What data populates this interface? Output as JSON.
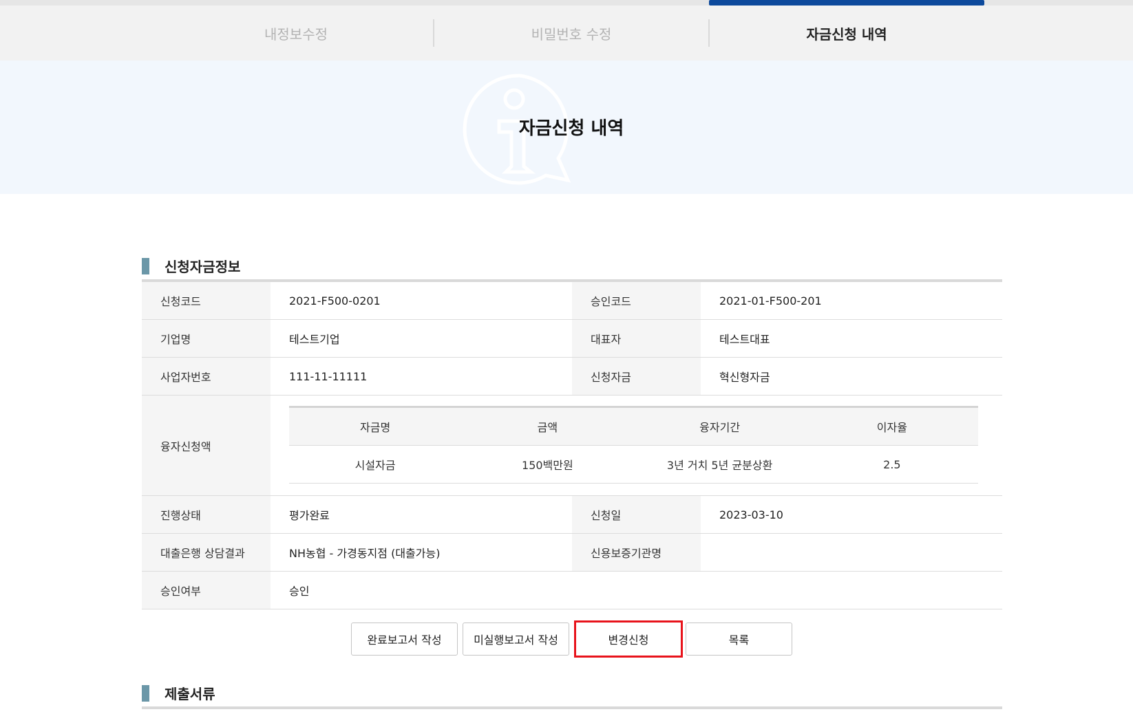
{
  "tabs": [
    {
      "label": "내정보수정",
      "active": false
    },
    {
      "label": "비밀번호 수정",
      "active": false
    },
    {
      "label": "자금신청 내역",
      "active": true
    }
  ],
  "hero": {
    "title": "자금신청 내역",
    "icon": "info-speech-icon"
  },
  "section1": {
    "title": "신청자금정보"
  },
  "info": {
    "apply_code_label": "신청코드",
    "apply_code": "2021-F500-0201",
    "approval_code_label": "승인코드",
    "approval_code": "2021-01-F500-201",
    "company_label": "기업명",
    "company": "테스트기업",
    "ceo_label": "대표자",
    "ceo": "테스트대표",
    "biz_no_label": "사업자번호",
    "biz_no": "111-11-11111",
    "fund_label": "신청자금",
    "fund": "혁신형자금",
    "loan_label": "융자신청액",
    "status_label": "진행상태",
    "status": "평가완료",
    "apply_date_label": "신청일",
    "apply_date": "2023-03-10",
    "bank_label": "대출은행 상담결과",
    "bank": "NH농협 - 가경동지점 (대출가능)",
    "guarantee_label": "신용보증기관명",
    "guarantee": "",
    "approval_label": "승인여부",
    "approval": "승인"
  },
  "loan_table": {
    "headers": [
      "자금명",
      "금액",
      "융자기간",
      "이자율"
    ],
    "row": [
      "시설자금",
      "150백만원",
      "3년 거치 5년 균분상환",
      "2.5"
    ]
  },
  "buttons": {
    "complete_report": "완료보고서 작성",
    "unexecuted_report": "미실행보고서 작성",
    "change_request": "변경신청",
    "list": "목록"
  },
  "section2": {
    "title": "제출서류"
  },
  "colors": {
    "accent": "#0d4a9c",
    "section_bar": "#6b97a8",
    "highlight": "#e8131b"
  }
}
